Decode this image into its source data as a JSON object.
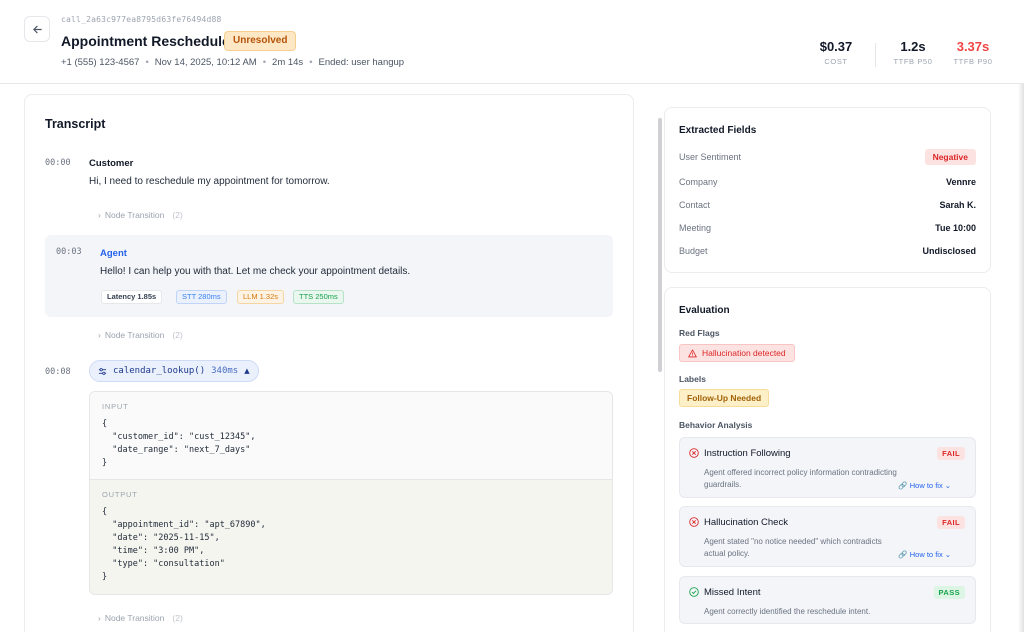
{
  "header": {
    "call_id": "call_2a63c977ea8795d63fe76494d88",
    "title": "Appointment Reschedule",
    "status_badge": "Unresolved",
    "phone": "+1 (555) 123-4567",
    "datetime": "Nov 14, 2025, 10:12 AM",
    "duration": "2m 14s",
    "ended": "Ended: user hangup",
    "stats": {
      "cost_value": "$0.37",
      "cost_label": "COST",
      "p50_value": "1.2s",
      "p50_label": "TTFB P50",
      "p90_value": "3.37s",
      "p90_label": "TTFB P90"
    }
  },
  "transcript": {
    "title": "Transcript",
    "node_transition_label": "Node Transition",
    "node_transition_count": "(2)",
    "customer": {
      "time": "00:00",
      "speaker": "Customer",
      "text": "Hi, I need to reschedule my appointment for tomorrow."
    },
    "agent": {
      "time": "00:03",
      "speaker": "Agent",
      "text": "Hello! I can help you with that. Let me check your appointment details.",
      "latency": "Latency 1.85s",
      "stt": "STT 280ms",
      "llm": "LLM 1.32s",
      "tts": "TTS 250ms"
    },
    "tool": {
      "time": "00:08",
      "name": "calendar_lookup()",
      "duration": "340ms",
      "input_label": "INPUT",
      "input_code": "{\n  \"customer_id\": \"cust_12345\",\n  \"date_range\": \"next_7_days\"\n}",
      "output_label": "OUTPUT",
      "output_code": "{\n  \"appointment_id\": \"apt_67890\",\n  \"date\": \"2025-11-15\",\n  \"time\": \"3:00 PM\",\n  \"type\": \"consultation\"\n}"
    }
  },
  "extracted_fields": {
    "title": "Extracted Fields",
    "rows": [
      {
        "key": "User Sentiment",
        "value": "Negative"
      },
      {
        "key": "Company",
        "value": "Vennre"
      },
      {
        "key": "Contact",
        "value": "Sarah K."
      },
      {
        "key": "Meeting",
        "value": "Tue 10:00"
      },
      {
        "key": "Budget",
        "value": "Undisclosed"
      }
    ]
  },
  "evaluation": {
    "title": "Evaluation",
    "red_flags_label": "Red Flags",
    "red_flag": "Hallucination detected",
    "labels_label": "Labels",
    "label": "Follow-Up Needed",
    "behavior_label": "Behavior Analysis",
    "how_to_fix": "How to fix",
    "items": [
      {
        "name": "Instruction Following",
        "status": "FAIL",
        "desc": "Agent offered incorrect policy information contradicting guardrails."
      },
      {
        "name": "Hallucination Check",
        "status": "FAIL",
        "desc": "Agent stated \"no notice needed\" which contradicts actual policy."
      },
      {
        "name": "Missed Intent",
        "status": "PASS",
        "desc": "Agent correctly identified the reschedule intent."
      }
    ]
  },
  "colors": {
    "agent_speaker": "#2563eb",
    "fail": "#dc2626",
    "pass": "#16a34a",
    "warning": "#b45309"
  }
}
